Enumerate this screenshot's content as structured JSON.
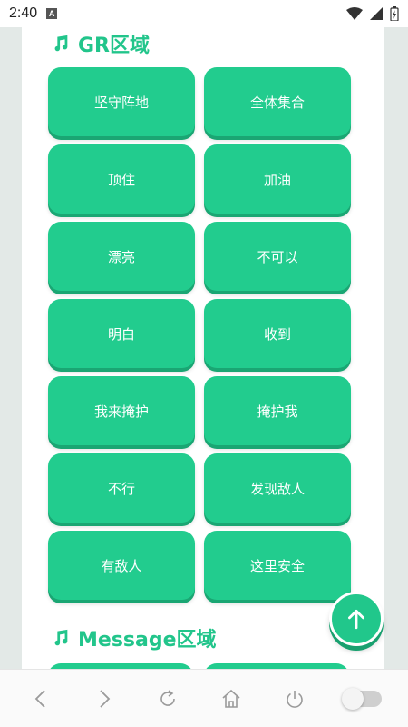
{
  "status": {
    "time": "2:40",
    "badge": "A"
  },
  "sections": {
    "gr_title": "GR区域",
    "message_title": "Message区域"
  },
  "gr_buttons": [
    "坚守阵地",
    "全体集合",
    "顶住",
    "加油",
    "漂亮",
    "不可以",
    "明白",
    "收到",
    "我来掩护",
    "掩护我",
    "不行",
    "发现敌人",
    "有敌人",
    "这里安全"
  ],
  "colors": {
    "accent": "#22cc8e",
    "accent_dark": "#1aa673",
    "title": "#22c58b"
  },
  "icons": {
    "section": "music-note-icon",
    "fab": "arrow-up-icon",
    "nav": [
      "back-icon",
      "forward-icon",
      "refresh-icon",
      "home-icon",
      "power-icon",
      "toggle-switch"
    ]
  }
}
